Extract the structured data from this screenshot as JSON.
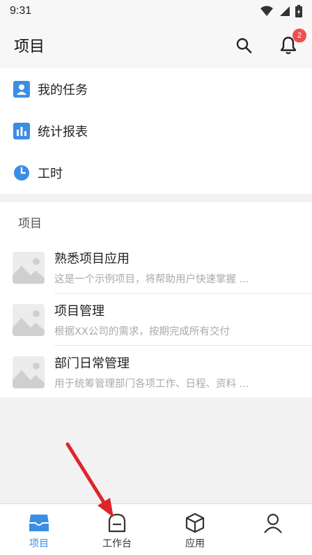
{
  "status_bar": {
    "time": "9:31"
  },
  "header": {
    "title": "项目",
    "notification_count": "2"
  },
  "quick_menu": [
    {
      "label": "我的任务",
      "icon": "person-icon"
    },
    {
      "label": "统计报表",
      "icon": "bar-chart-icon"
    },
    {
      "label": "工时",
      "icon": "clock-icon"
    }
  ],
  "projects": {
    "title": "项目",
    "items": [
      {
        "name": "熟悉项目应用",
        "desc": "这是一个示例项目，将帮助用户快速掌握 ..."
      },
      {
        "name": "项目管理",
        "desc": "根据XX公司的需求，按期完成所有交付"
      },
      {
        "name": "部门日常管理",
        "desc": "用于统筹管理部门各项工作、日程、资料 ..."
      }
    ]
  },
  "bottom_nav": [
    {
      "label": "项目",
      "icon": "inbox-icon",
      "active": true
    },
    {
      "label": "工作台",
      "icon": "desk-icon",
      "active": false
    },
    {
      "label": "应用",
      "icon": "cube-icon",
      "active": false
    },
    {
      "label": "",
      "icon": "user-icon",
      "active": false
    }
  ],
  "colors": {
    "accent": "#3a8ee6",
    "badge": "#f04e4e",
    "arrow": "#e0242b"
  }
}
